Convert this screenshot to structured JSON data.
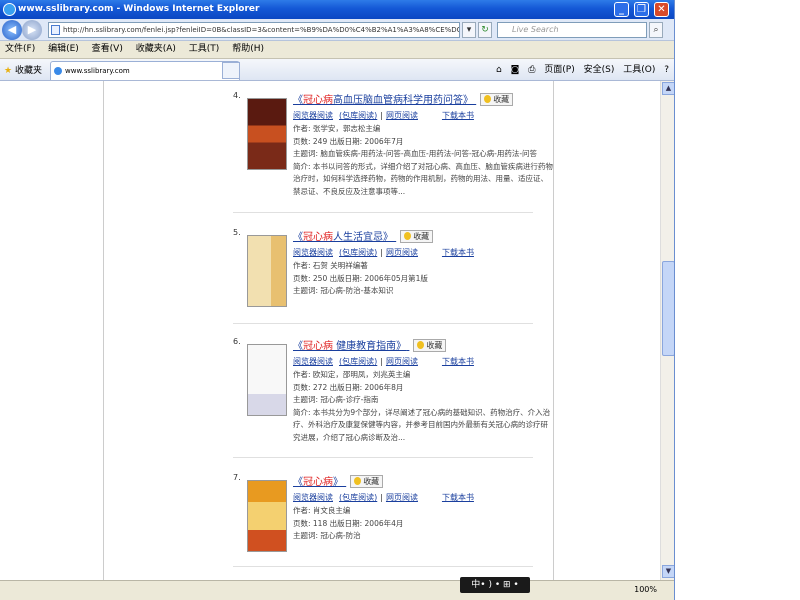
{
  "window": {
    "title": "www.sslibrary.com - Windows Internet Explorer",
    "min": "_",
    "max": "❐",
    "close": "✕"
  },
  "address": {
    "url": "http://hn.sslibrary.com/fenlei.jsp?fenleiID=0B&classID=3&content=%B9%DA%D0%C4%B2%A1%A3%A8%CE%DC%9F%A8&username=ngsyk",
    "search_placeholder": "Live Search"
  },
  "menu": [
    "文件(F)",
    "编辑(E)",
    "查看(V)",
    "收藏夹(A)",
    "工具(T)",
    "帮助(H)"
  ],
  "favbar": {
    "favorites": "收藏夹",
    "tab": "www.sslibrary.com",
    "cmd": [
      "页面(P)",
      "安全(S)",
      "工具(O)"
    ]
  },
  "results": [
    {
      "num": "4.",
      "title_pre": "《",
      "title_hl": "冠心病",
      "title_post": "高血压脑血管病科学用药问答》",
      "collect": "收藏",
      "cover_color": "#5a1a10",
      "links": [
        "阅览器阅读",
        "(包库阅读)",
        "网页阅读"
      ],
      "download": "下载本书",
      "info": [
        "作者: 张学安，郭志松主编",
        "页数: 249    出版日期: 2006年7月",
        "主题词: 脑血管疾病-用药法-问答-高血压-用药法-问答-冠心病-用药法-问答",
        "简介: 本书以问答的形式，详细介绍了对冠心病、高血压、脑血管疾病进行药物治疗时，如何科学选择药物，药物的作用机制，药物的用法、用量、适应证、禁忌证、不良反应及注意事项等..."
      ]
    },
    {
      "num": "5.",
      "title_pre": "《",
      "title_hl": "冠心病",
      "title_post": "人生活宜忌》",
      "collect": "收藏",
      "cover_color": "#f2e0b0",
      "links": [
        "阅览器阅读",
        "(包库阅读)",
        "网页阅读"
      ],
      "download": "下载本书",
      "info": [
        "作者: 石贺  关明祥编著",
        "页数: 250    出版日期: 2006年05月第1版",
        "主题词: 冠心病-防治-基本知识"
      ]
    },
    {
      "num": "6.",
      "title_pre": "《",
      "title_hl": "冠心病",
      "title_post": " 健康教育指南》",
      "collect": "收藏",
      "cover_color": "#f8f8f8",
      "links": [
        "阅览器阅读",
        "(包库阅读)",
        "网页阅读"
      ],
      "download": "下载本书",
      "info": [
        "作者: 欧知定，邵明凤，刘兆英主编",
        "页数: 272    出版日期: 2006年8月",
        "主题词: 冠心病-诊疗-指南",
        "简介: 本书共分为9个部分，详尽阐述了冠心病的基础知识、药物治疗、介入治疗、外科治疗及康复保健等内容，并参考目前国内外最新有关冠心病的诊疗研究进展，介绍了冠心病诊断及治..."
      ]
    },
    {
      "num": "7.",
      "title_pre": "《",
      "title_hl": "冠心病",
      "title_post": "》",
      "collect": "收藏",
      "cover_color": "#e89a20",
      "links": [
        "阅览器阅读",
        "(包库阅读)",
        "网页阅读"
      ],
      "download": "下载本书",
      "info": [
        "作者: 肖文良主编",
        "页数: 118    出版日期: 2006年4月",
        "主题词: 冠心病-防治"
      ]
    }
  ],
  "status": {
    "zoom": "100%",
    "ime": "中• ) • ⊞ •"
  }
}
